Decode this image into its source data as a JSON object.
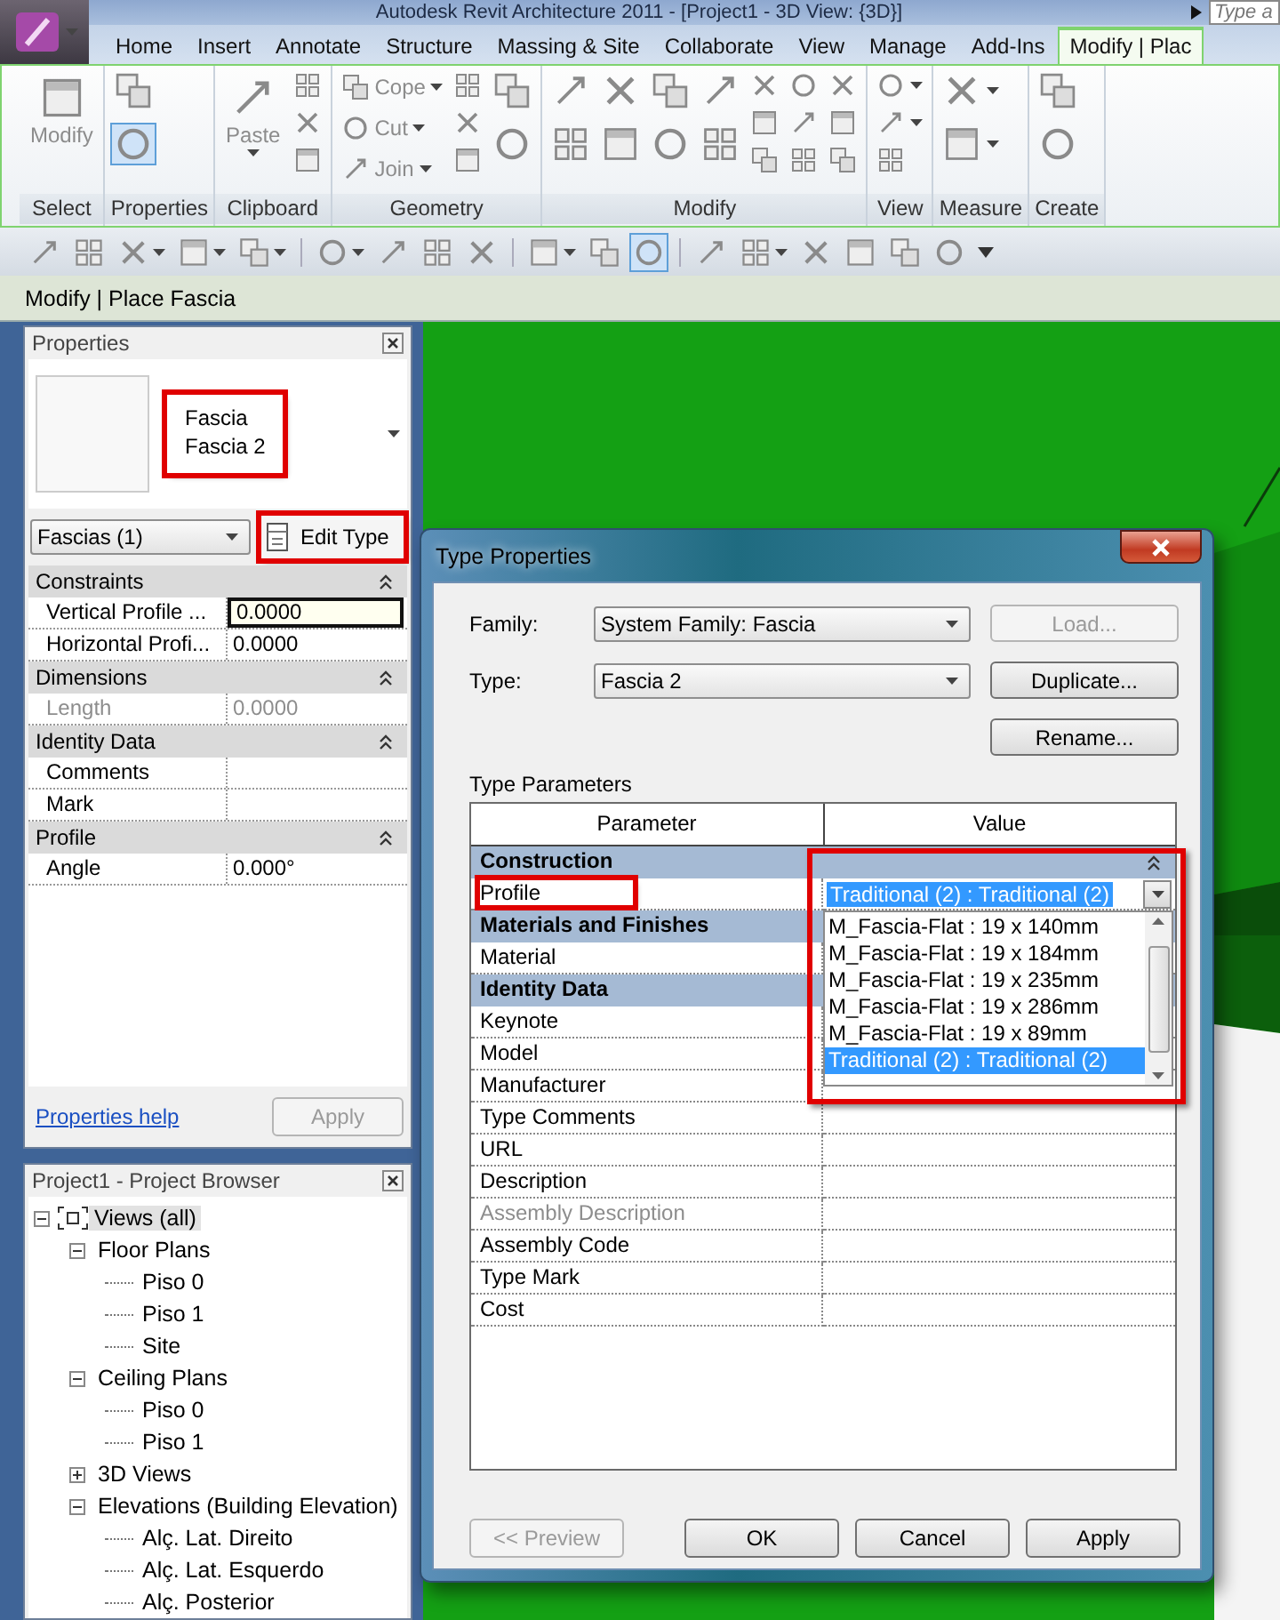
{
  "app": {
    "title": "Autodesk Revit Architecture 2011 - [Project1 - 3D View: {3D}]",
    "search": {
      "placeholder": "Type a"
    }
  },
  "ribbon_tabs": [
    {
      "label": "Home",
      "selected": false
    },
    {
      "label": "Insert",
      "selected": false
    },
    {
      "label": "Annotate",
      "selected": false
    },
    {
      "label": "Structure",
      "selected": false
    },
    {
      "label": "Massing & Site",
      "selected": false
    },
    {
      "label": "Collaborate",
      "selected": false
    },
    {
      "label": "View",
      "selected": false
    },
    {
      "label": "Manage",
      "selected": false
    },
    {
      "label": "Add-Ins",
      "selected": false
    },
    {
      "label": "Modify | Plac",
      "selected": true
    }
  ],
  "ribbon_panels": [
    {
      "label": "Select",
      "tools": [
        {
          "kind": "large",
          "label": "Modify",
          "caret": false,
          "active": false
        }
      ]
    },
    {
      "label": "Properties",
      "tools": [
        {
          "kind": "column",
          "items": [
            {
              "caret": false,
              "active": false
            },
            {
              "caret": false,
              "active": true
            }
          ]
        }
      ]
    },
    {
      "label": "Clipboard",
      "tools": [
        {
          "kind": "large",
          "label": "Paste",
          "caret": true,
          "active": false
        },
        {
          "kind": "column",
          "items": [
            {
              "caret": false,
              "active": false
            },
            {
              "caret": false,
              "active": false
            },
            {
              "caret": false,
              "active": false
            }
          ]
        }
      ]
    },
    {
      "label": "Geometry",
      "tools": [
        {
          "kind": "column",
          "items": [
            {
              "label": "Cope",
              "caret": true,
              "active": false
            },
            {
              "label": "Cut",
              "caret": true,
              "active": false
            },
            {
              "label": "Join",
              "caret": true,
              "active": false
            }
          ]
        },
        {
          "kind": "column",
          "items": [
            {
              "caret": false,
              "active": false
            },
            {
              "caret": false,
              "active": false
            },
            {
              "caret": false,
              "active": false
            }
          ]
        },
        {
          "kind": "column",
          "items": [
            {
              "caret": false,
              "active": false
            },
            {
              "caret": false,
              "active": false
            }
          ]
        }
      ]
    },
    {
      "label": "Modify",
      "tools": [
        {
          "kind": "column",
          "items": [
            {
              "caret": false,
              "active": false
            },
            {
              "caret": false,
              "active": false
            }
          ]
        },
        {
          "kind": "column",
          "items": [
            {
              "caret": false,
              "active": false
            },
            {
              "caret": false,
              "active": false
            }
          ]
        },
        {
          "kind": "column",
          "items": [
            {
              "caret": false,
              "active": false
            },
            {
              "caret": false,
              "active": false
            }
          ]
        },
        {
          "kind": "column",
          "items": [
            {
              "caret": false,
              "active": false
            },
            {
              "caret": false,
              "active": false
            }
          ]
        },
        {
          "kind": "column",
          "items": [
            {
              "caret": false,
              "active": false
            },
            {
              "caret": false,
              "active": false
            },
            {
              "caret": false,
              "active": false
            }
          ]
        },
        {
          "kind": "column",
          "items": [
            {
              "caret": false,
              "active": false
            },
            {
              "caret": false,
              "active": false
            },
            {
              "caret": false,
              "active": false
            }
          ]
        },
        {
          "kind": "column",
          "items": [
            {
              "caret": false,
              "active": false
            },
            {
              "caret": false,
              "active": false
            },
            {
              "caret": false,
              "active": false
            }
          ]
        }
      ]
    },
    {
      "label": "View",
      "tools": [
        {
          "kind": "column",
          "items": [
            {
              "caret": true,
              "active": false
            },
            {
              "caret": true,
              "active": false
            },
            {
              "caret": false,
              "active": false
            }
          ]
        }
      ]
    },
    {
      "label": "Measure",
      "tools": [
        {
          "kind": "column",
          "items": [
            {
              "caret": true,
              "active": false
            },
            {
              "caret": true,
              "active": false
            }
          ]
        }
      ]
    },
    {
      "label": "Create",
      "tools": [
        {
          "kind": "column",
          "items": [
            {
              "caret": false,
              "active": false
            },
            {
              "caret": false,
              "active": false
            }
          ]
        }
      ]
    }
  ],
  "quick_access": [
    {
      "kind": "icon",
      "caret": false,
      "active": false
    },
    {
      "kind": "icon",
      "caret": false,
      "active": false
    },
    {
      "kind": "icon",
      "caret": true,
      "active": false
    },
    {
      "kind": "icon",
      "caret": true,
      "active": false
    },
    {
      "kind": "icon",
      "caret": true,
      "active": false
    },
    {
      "kind": "separator"
    },
    {
      "kind": "icon",
      "caret": true,
      "active": false
    },
    {
      "kind": "icon",
      "caret": false,
      "active": false
    },
    {
      "kind": "icon",
      "caret": false,
      "active": false
    },
    {
      "kind": "icon",
      "caret": false,
      "active": false
    },
    {
      "kind": "separator"
    },
    {
      "kind": "icon",
      "caret": true,
      "active": false
    },
    {
      "kind": "icon",
      "caret": false,
      "active": false
    },
    {
      "kind": "icon",
      "caret": false,
      "active": true
    },
    {
      "kind": "separator"
    },
    {
      "kind": "icon",
      "caret": false,
      "active": false
    },
    {
      "kind": "icon",
      "caret": true,
      "active": false
    },
    {
      "kind": "icon",
      "caret": false,
      "active": false
    },
    {
      "kind": "icon",
      "caret": false,
      "active": false
    },
    {
      "kind": "icon",
      "caret": false,
      "active": false
    },
    {
      "kind": "icon",
      "caret": false,
      "active": false
    },
    {
      "kind": "menu"
    }
  ],
  "context_bar": "Modify | Place Fascia",
  "properties": {
    "title": "Properties",
    "type_preview": {
      "family": "Fascia",
      "type": "Fascia 2",
      "highlighted": true
    },
    "instance_filter": "Fascias (1)",
    "edit_type": {
      "label": "Edit Type",
      "highlighted": true
    },
    "rows": [
      {
        "kind": "group",
        "label": "Constraints"
      },
      {
        "kind": "param",
        "name": "Vertical Profile ...",
        "value": "0.0000",
        "editing": true,
        "disabled": false
      },
      {
        "kind": "param",
        "name": "Horizontal Profi...",
        "value": "0.0000",
        "editing": false,
        "disabled": false
      },
      {
        "kind": "group",
        "label": "Dimensions"
      },
      {
        "kind": "param",
        "name": "Length",
        "value": "0.0000",
        "editing": false,
        "disabled": true
      },
      {
        "kind": "group",
        "label": "Identity Data"
      },
      {
        "kind": "param",
        "name": "Comments",
        "editing": false,
        "disabled": false
      },
      {
        "kind": "param",
        "name": "Mark",
        "editing": false,
        "disabled": false
      },
      {
        "kind": "group",
        "label": "Profile"
      },
      {
        "kind": "param",
        "name": "Angle",
        "value": "0.000°",
        "editing": false,
        "disabled": false
      }
    ],
    "help_link": "Properties help",
    "apply": {
      "label": "Apply",
      "disabled": true
    }
  },
  "browser": {
    "title": "Project1 - Project Browser",
    "tree": [
      {
        "kind": "root",
        "label": "Views (all)",
        "expanded": true,
        "selected": true,
        "children": [
          {
            "kind": "folder",
            "label": "Floor Plans",
            "expanded": true,
            "selected": false,
            "children": [
              {
                "kind": "view",
                "label": "Piso 0",
                "selected": false
              },
              {
                "kind": "view",
                "label": "Piso 1",
                "selected": false
              },
              {
                "kind": "view",
                "label": "Site",
                "selected": false
              }
            ]
          },
          {
            "kind": "folder",
            "label": "Ceiling Plans",
            "expanded": true,
            "selected": false,
            "children": [
              {
                "kind": "view",
                "label": "Piso 0",
                "selected": false
              },
              {
                "kind": "view",
                "label": "Piso 1",
                "selected": false
              }
            ]
          },
          {
            "kind": "folder",
            "label": "3D Views",
            "expanded": false,
            "selected": false
          },
          {
            "kind": "folder",
            "label": "Elevations (Building Elevation)",
            "expanded": true,
            "selected": false,
            "children": [
              {
                "kind": "view",
                "label": "Alç. Lat. Direito",
                "selected": false
              },
              {
                "kind": "view",
                "label": "Alç. Lat. Esquerdo",
                "selected": false
              },
              {
                "kind": "view",
                "label": "Alç. Posterior",
                "selected": false
              }
            ]
          }
        ]
      }
    ]
  },
  "type_properties": {
    "title": "Type Properties",
    "family": {
      "label": "Family:",
      "value": "System Family: Fascia"
    },
    "type": {
      "label": "Type:",
      "value": "Fascia 2"
    },
    "side_buttons": [
      {
        "label": "Load...",
        "disabled": true
      },
      {
        "label": "Duplicate...",
        "disabled": false
      },
      {
        "label": "Rename...",
        "disabled": false
      }
    ],
    "section_label": "Type Parameters",
    "columns": [
      "Parameter",
      "Value"
    ],
    "rows": [
      {
        "kind": "group",
        "label": "Construction",
        "toggle": true
      },
      {
        "kind": "combo_param",
        "name": "Profile",
        "value": "Traditional (2) : Traditional (2)",
        "highlighted": true,
        "disabled": false,
        "dropdown": {
          "highlighted": true,
          "options": [
            {
              "label": "M_Fascia-Flat : 19 x 140mm",
              "selected": false
            },
            {
              "label": "M_Fascia-Flat : 19 x 184mm",
              "selected": false
            },
            {
              "label": "M_Fascia-Flat : 19 x 235mm",
              "selected": false
            },
            {
              "label": "M_Fascia-Flat : 19 x 286mm",
              "selected": false
            },
            {
              "label": "M_Fascia-Flat : 19 x 89mm",
              "selected": false
            },
            {
              "label": "Traditional (2) : Traditional (2)",
              "selected": true
            }
          ]
        }
      },
      {
        "kind": "group",
        "label": "Materials and Finishes"
      },
      {
        "kind": "param",
        "name": "Material",
        "highlighted": false,
        "disabled": false
      },
      {
        "kind": "group",
        "label": "Identity Data"
      },
      {
        "kind": "param",
        "name": "Keynote",
        "highlighted": false,
        "disabled": false
      },
      {
        "kind": "param",
        "name": "Model",
        "highlighted": false,
        "disabled": false
      },
      {
        "kind": "param",
        "name": "Manufacturer",
        "highlighted": false,
        "disabled": false
      },
      {
        "kind": "param",
        "name": "Type Comments",
        "highlighted": false,
        "disabled": false
      },
      {
        "kind": "param",
        "name": "URL",
        "highlighted": false,
        "disabled": false
      },
      {
        "kind": "param",
        "name": "Description",
        "highlighted": false,
        "disabled": false
      },
      {
        "kind": "param",
        "name": "Assembly Description",
        "highlighted": false,
        "disabled": true
      },
      {
        "kind": "param",
        "name": "Assembly Code",
        "highlighted": false,
        "disabled": false
      },
      {
        "kind": "param",
        "name": "Type Mark",
        "highlighted": false,
        "disabled": false
      },
      {
        "kind": "param",
        "name": "Cost",
        "highlighted": false,
        "disabled": false
      }
    ],
    "preview_button": {
      "label": "<< Preview",
      "disabled": true
    },
    "buttons": [
      {
        "label": "OK",
        "disabled": false
      },
      {
        "label": "Cancel",
        "disabled": false
      },
      {
        "label": "Apply",
        "disabled": false
      }
    ]
  }
}
